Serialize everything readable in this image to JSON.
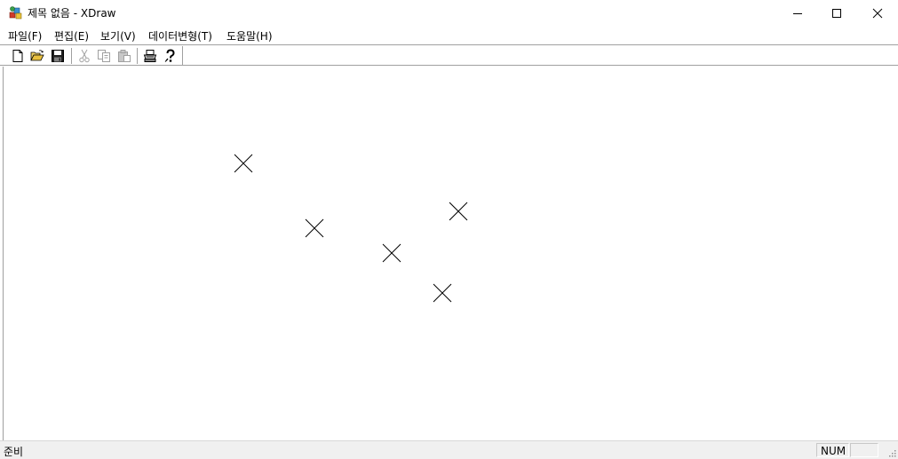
{
  "window": {
    "title": "제목 없음 - XDraw",
    "app_icon": "xdraw-app-icon",
    "controls": [
      "minimize-icon",
      "maximize-icon",
      "close-icon"
    ]
  },
  "menu": {
    "items": [
      {
        "label": "파일(F)"
      },
      {
        "label": "편집(E)"
      },
      {
        "label": "보기(V)"
      },
      {
        "label": "데이터변형(T)"
      },
      {
        "label": "도움말(H)"
      }
    ]
  },
  "toolbar": {
    "buttons": [
      {
        "icon": "new-document-icon",
        "enabled": true
      },
      {
        "icon": "open-folder-icon",
        "enabled": true
      },
      {
        "icon": "save-disk-icon",
        "enabled": true
      },
      {
        "icon": "cut-icon",
        "enabled": false
      },
      {
        "icon": "copy-icon",
        "enabled": false
      },
      {
        "icon": "paste-icon",
        "enabled": false
      },
      {
        "icon": "print-icon",
        "enabled": true
      },
      {
        "icon": "help-icon",
        "enabled": true
      }
    ]
  },
  "canvas": {
    "point_count": 5,
    "marker_icon": "x-marker-icon"
  },
  "statusbar": {
    "text": "준비",
    "num_indicator": "NUM"
  },
  "colors": {
    "background": "#ffffff",
    "border": "#a0a0a0",
    "statusbar_bg": "#f0f0f0",
    "marker": "#000000"
  }
}
